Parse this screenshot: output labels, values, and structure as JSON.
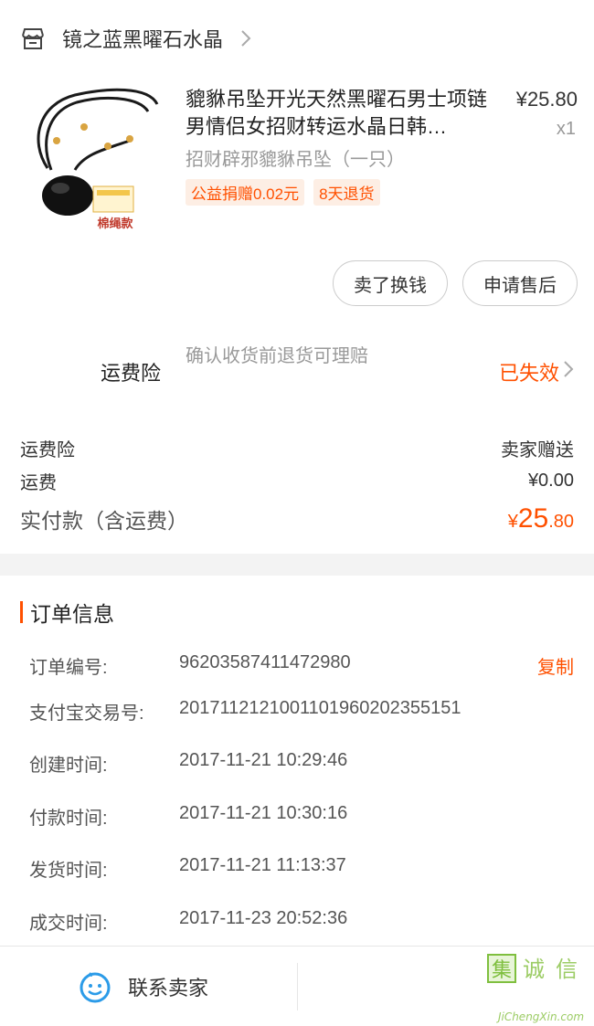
{
  "shop": {
    "name": "镜之蓝黑曜石水晶"
  },
  "product": {
    "title": "貔貅吊坠开光天然黑曜石男士项链男情侣女招财转运水晶日韩…",
    "price": "¥25.80",
    "qty": "x1",
    "sku": "招财辟邪貔貅吊坠（一只）",
    "tags": [
      "公益捐赠0.02元",
      "8天退货"
    ],
    "thumb_badge": "棉绳款"
  },
  "actions": {
    "sell": "卖了换钱",
    "after_sale": "申请售后"
  },
  "insurance": {
    "label": "运费险",
    "desc": "确认收货前退货可理赔",
    "status": "已失效"
  },
  "fees": {
    "insurance_label": "运费险",
    "insurance_value": "卖家赠送",
    "shipping_label": "运费",
    "shipping_value": "¥0.00",
    "total_label": "实付款（含运费）",
    "total_currency": "¥",
    "total_int": "25",
    "total_dec": ".80"
  },
  "order": {
    "title": "订单信息",
    "copy": "复制",
    "rows": [
      {
        "label": "订单编号:",
        "value": "96203587411472980"
      },
      {
        "label": "支付宝交易号:",
        "value": "2017112121001101960202355151"
      },
      {
        "label": "创建时间:",
        "value": "2017-11-21 10:29:46"
      },
      {
        "label": "付款时间:",
        "value": "2017-11-21 10:30:16"
      },
      {
        "label": "发货时间:",
        "value": "2017-11-21 11:13:37"
      },
      {
        "label": "成交时间:",
        "value": "2017-11-23 20:52:36"
      }
    ]
  },
  "bottom": {
    "contact": "联系卖家"
  },
  "watermark": {
    "text": "JiChengXin.com"
  },
  "colors": {
    "accent": "#ff5000",
    "contact_icon": "#2b9be8"
  }
}
